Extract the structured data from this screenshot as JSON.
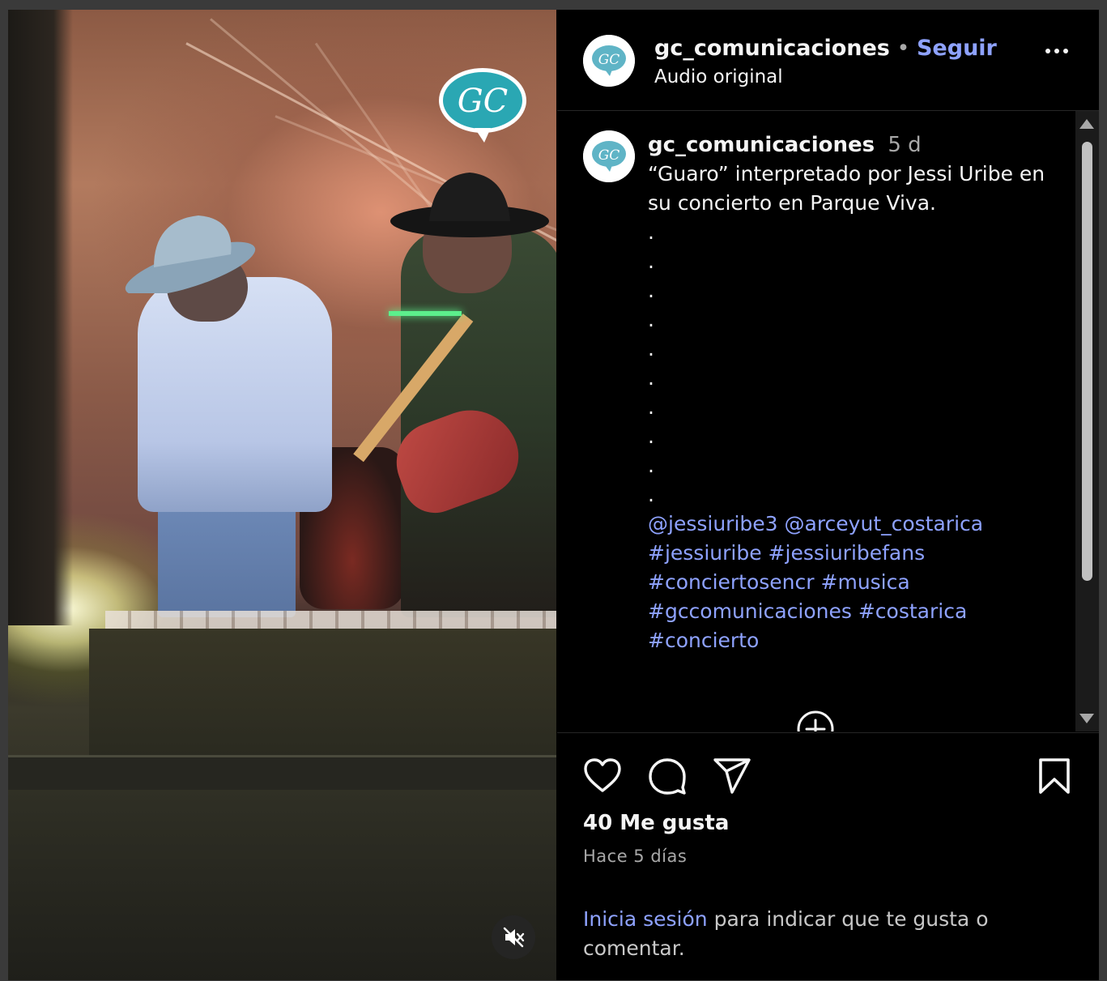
{
  "post": {
    "username": "gc_comunicaciones",
    "follow_separator": "•",
    "follow_label": "Seguir",
    "audio_label": "Audio original",
    "watermark_text": "GC",
    "avatar_text": "GC"
  },
  "caption": {
    "username": "gc_comunicaciones",
    "age": "5 d",
    "text_line1": "“Guaro” interpretado por Jessi Uribe en",
    "text_line2": "su concierto en Parque Viva.",
    "dots": [
      ".",
      ".",
      ".",
      ".",
      ".",
      ".",
      ".",
      ".",
      ".",
      "."
    ],
    "tags_line1": [
      "@jessiuribe3",
      "@arceyut_costarica"
    ],
    "tags_line2": [
      "#jessiuribe",
      "#jessiuribefans"
    ],
    "tags_line3": [
      "#conciertosencr",
      "#musica"
    ],
    "tags_line4": [
      "#gccomunicaciones",
      "#costarica"
    ],
    "tags_line5": [
      "#concierto"
    ]
  },
  "actions": {
    "icons": [
      "heart-icon",
      "comment-icon",
      "share-icon",
      "bookmark-icon"
    ],
    "likes": "40 Me gusta",
    "date": "Hace 5 días",
    "login_link": "Inicia sesión",
    "login_rest": "para indicar que te gusta o",
    "login_rest2": "comentar."
  },
  "colors": {
    "background": "#000000",
    "link": "#8ea2ff",
    "muted": "#a8a8a8",
    "badge": "#2aa7b3"
  }
}
